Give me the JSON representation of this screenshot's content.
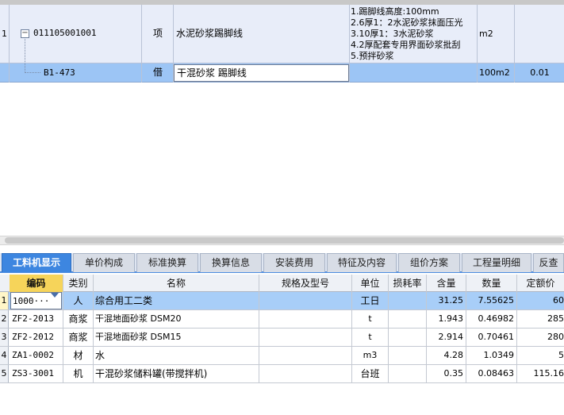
{
  "top_grid": {
    "row1": {
      "num": "1",
      "code": "011105001001",
      "type": "项",
      "name": "水泥砂浆踢脚线",
      "features": [
        "1.踢脚线高度:100mm",
        "2.6厚1：2水泥砂浆抹面压光",
        "3.10厚1：3水泥砂浆",
        "4.2厚配套专用界面砂浆批刮",
        "5.预拌砂浆"
      ],
      "unit": "m2",
      "expander": "−"
    },
    "row2": {
      "code": "B1-473",
      "type": "借",
      "name": "干混砂浆 踢脚线",
      "unit": "100m2",
      "qty": "0.01"
    }
  },
  "tabs": [
    "工料机显示",
    "单价构成",
    "标准换算",
    "换算信息",
    "安装费用",
    "特征及内容",
    "组价方案",
    "工程量明细",
    "反查"
  ],
  "grid": {
    "headers": [
      "编码",
      "类别",
      "名称",
      "规格及型号",
      "单位",
      "损耗率",
      "含量",
      "数量",
      "定额价"
    ],
    "rows": [
      {
        "num": "1",
        "code": "1000···",
        "cat": "人",
        "name": "综合用工二类",
        "spec": "",
        "unit": "工日",
        "loss": "",
        "content": "31.25",
        "qty": "7.55625",
        "price": "60"
      },
      {
        "num": "2",
        "code": "ZF2-2013",
        "cat": "商浆",
        "name": "干混地面砂浆 DSM20",
        "spec": "",
        "unit": "t",
        "loss": "",
        "content": "1.943",
        "qty": "0.46982",
        "price": "285"
      },
      {
        "num": "3",
        "code": "ZF2-2012",
        "cat": "商浆",
        "name": "干混地面砂浆 DSM15",
        "spec": "",
        "unit": "t",
        "loss": "",
        "content": "2.914",
        "qty": "0.70461",
        "price": "280"
      },
      {
        "num": "4",
        "code": "ZA1-0002",
        "cat": "材",
        "name": "水",
        "spec": "",
        "unit": "m3",
        "loss": "",
        "content": "4.28",
        "qty": "1.0349",
        "price": "5"
      },
      {
        "num": "5",
        "code": "ZS3-3001",
        "cat": "机",
        "name": "干混砂浆储料罐(带搅拌机)",
        "spec": "",
        "unit": "台班",
        "loss": "",
        "content": "0.35",
        "qty": "0.08463",
        "price": "115.16"
      }
    ]
  },
  "colors": {
    "selected_row": "#a8cef8",
    "active_tab": "#3d86e0",
    "header_highlight": "#f6d45a"
  }
}
